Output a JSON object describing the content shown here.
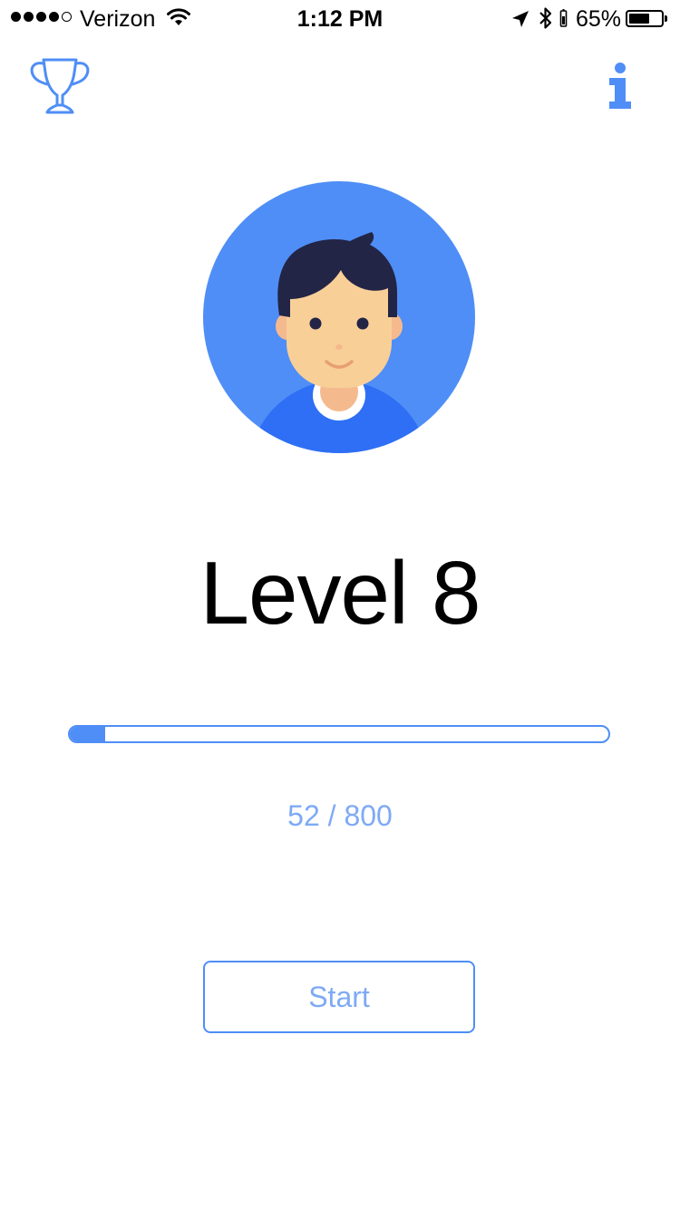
{
  "status_bar": {
    "signal_bars_filled": 4,
    "signal_bars_total": 5,
    "carrier": "Verizon",
    "time": "1:12 PM",
    "battery_percent_text": "65%",
    "battery_level": 0.65,
    "icons": [
      "wifi-icon",
      "location-arrow-icon",
      "bluetooth-icon",
      "battery-icon"
    ]
  },
  "top_bar": {
    "left_icon": "trophy-icon",
    "right_icon": "info-icon"
  },
  "profile": {
    "avatar_icon": "boy-avatar-icon"
  },
  "level": {
    "title": "Level 8"
  },
  "progress": {
    "current": 52,
    "total": 800,
    "separator": " / "
  },
  "actions": {
    "start_label": "Start"
  },
  "colors": {
    "accent": "#4f8ef6",
    "accent_light": "#7eaaf4",
    "avatar_background": "#4f8ef6",
    "hair": "#232546",
    "skin": "#f9cf98",
    "shirt": "#2e6ff5"
  }
}
